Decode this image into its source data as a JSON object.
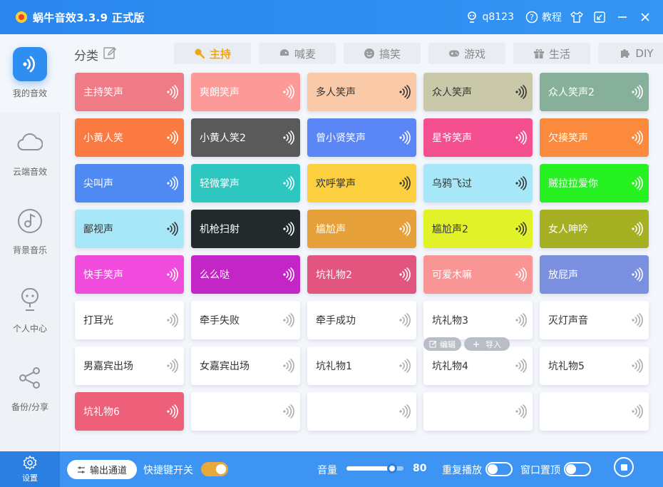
{
  "titlebar": {
    "app_title": "蜗牛音效3.3.9 正式版",
    "user": "q8123",
    "tutorial": "教程",
    "icons": [
      "user-icon",
      "help-icon",
      "shirt-icon",
      "shrink-icon",
      "minimize-icon",
      "close-icon"
    ]
  },
  "sidebar": {
    "items": [
      {
        "label": "我的音效",
        "icon": "sound-icon",
        "active": true
      },
      {
        "label": "云端音效",
        "icon": "cloud-icon",
        "active": false
      },
      {
        "label": "背景音乐",
        "icon": "music-icon",
        "active": false
      },
      {
        "label": "个人中心",
        "icon": "person-icon",
        "active": false
      },
      {
        "label": "备份/分享",
        "icon": "share-icon",
        "active": false
      }
    ]
  },
  "category": {
    "label": "分类",
    "tabs": [
      {
        "label": "主持",
        "icon": "host-icon",
        "active": true
      },
      {
        "label": "喊麦",
        "icon": "mic-icon",
        "active": false
      },
      {
        "label": "搞笑",
        "icon": "smile-icon",
        "active": false
      },
      {
        "label": "游戏",
        "icon": "gamepad-icon",
        "active": false
      },
      {
        "label": "生活",
        "icon": "gift-icon",
        "active": false
      },
      {
        "label": "DIY",
        "icon": "puzzle-icon",
        "active": false
      }
    ]
  },
  "sounds": [
    {
      "name": "主持笑声",
      "color": "#ee7b85",
      "text": "#ffffff"
    },
    {
      "name": "爽朗笑声",
      "color": "#fb9a96",
      "text": "#ffffff"
    },
    {
      "name": "多人笑声",
      "color": "#facaa8",
      "text": "#333333"
    },
    {
      "name": "众人笑声",
      "color": "#c9c8a8",
      "text": "#333333"
    },
    {
      "name": "众人笑声2",
      "color": "#86b09a",
      "text": "#ffffff"
    },
    {
      "name": "小黄人笑",
      "color": "#fa7a42",
      "text": "#ffffff"
    },
    {
      "name": "小黄人笑2",
      "color": "#5a5a5a",
      "text": "#ffffff"
    },
    {
      "name": "曾小贤笑声",
      "color": "#5b86f5",
      "text": "#ffffff"
    },
    {
      "name": "星爷笑声",
      "color": "#f44f90",
      "text": "#ffffff"
    },
    {
      "name": "欠揍笑声",
      "color": "#fb8a3c",
      "text": "#ffffff"
    },
    {
      "name": "尖叫声",
      "color": "#4f8af2",
      "text": "#ffffff"
    },
    {
      "name": "轻微掌声",
      "color": "#2ec7c0",
      "text": "#ffffff"
    },
    {
      "name": "欢呼掌声",
      "color": "#fbcf3e",
      "text": "#333333"
    },
    {
      "name": "乌鸦飞过",
      "color": "#a8e7f8",
      "text": "#333333"
    },
    {
      "name": "贼拉拉爱你",
      "color": "#26f222",
      "text": "#ffffff"
    },
    {
      "name": "鄙视声",
      "color": "#a8e7f8",
      "text": "#333333"
    },
    {
      "name": "机枪扫射",
      "color": "#232a2b",
      "text": "#ffffff"
    },
    {
      "name": "尴尬声",
      "color": "#e7a13a",
      "text": "#ffffff"
    },
    {
      "name": "尴尬声2",
      "color": "#e2f228",
      "text": "#333333"
    },
    {
      "name": "女人呻吟",
      "color": "#a6b023",
      "text": "#ffffff"
    },
    {
      "name": "快手笑声",
      "color": "#f04bdc",
      "text": "#ffffff"
    },
    {
      "name": "么么哒",
      "color": "#c425c6",
      "text": "#ffffff"
    },
    {
      "name": "坑礼物2",
      "color": "#e2557e",
      "text": "#ffffff"
    },
    {
      "name": "可爱木嘛",
      "color": "#fa9595",
      "text": "#ffffff"
    },
    {
      "name": "放屁声",
      "color": "#7a8fe0",
      "text": "#ffffff"
    },
    {
      "name": "打耳光",
      "color": "#ffffff",
      "text": "#333333"
    },
    {
      "name": "牵手失败",
      "color": "#ffffff",
      "text": "#333333"
    },
    {
      "name": "牵手成功",
      "color": "#ffffff",
      "text": "#333333"
    },
    {
      "name": "坑礼物3",
      "color": "#ffffff",
      "text": "#333333"
    },
    {
      "name": "灭灯声音",
      "color": "#ffffff",
      "text": "#333333"
    },
    {
      "name": "男嘉宾出场",
      "color": "#ffffff",
      "text": "#333333"
    },
    {
      "name": "女嘉宾出场",
      "color": "#ffffff",
      "text": "#333333"
    },
    {
      "name": "坑礼物1",
      "color": "#ffffff",
      "text": "#333333"
    },
    {
      "name": "坑礼物4",
      "color": "#ffffff",
      "text": "#333333"
    },
    {
      "name": "坑礼物5",
      "color": "#ffffff",
      "text": "#333333"
    },
    {
      "name": "坑礼物6",
      "color": "#ee5f7a",
      "text": "#ffffff"
    },
    {
      "name": "",
      "color": "#ffffff",
      "text": "#333333"
    },
    {
      "name": "",
      "color": "#ffffff",
      "text": "#333333"
    },
    {
      "name": "",
      "color": "#ffffff",
      "text": "#333333"
    },
    {
      "name": "",
      "color": "#ffffff",
      "text": "#333333"
    }
  ],
  "card_actions": {
    "edit": "编辑",
    "import": "导入"
  },
  "bottombar": {
    "settings": "设置",
    "output_channel": "输出通道",
    "hotkey_switch": "快捷键开关",
    "hotkey_on": true,
    "volume_label": "音量",
    "volume_value": "80",
    "volume_fraction": 0.8,
    "repeat_label": "重复播放",
    "repeat_on": false,
    "pin_label": "窗口置顶",
    "pin_on": false
  }
}
